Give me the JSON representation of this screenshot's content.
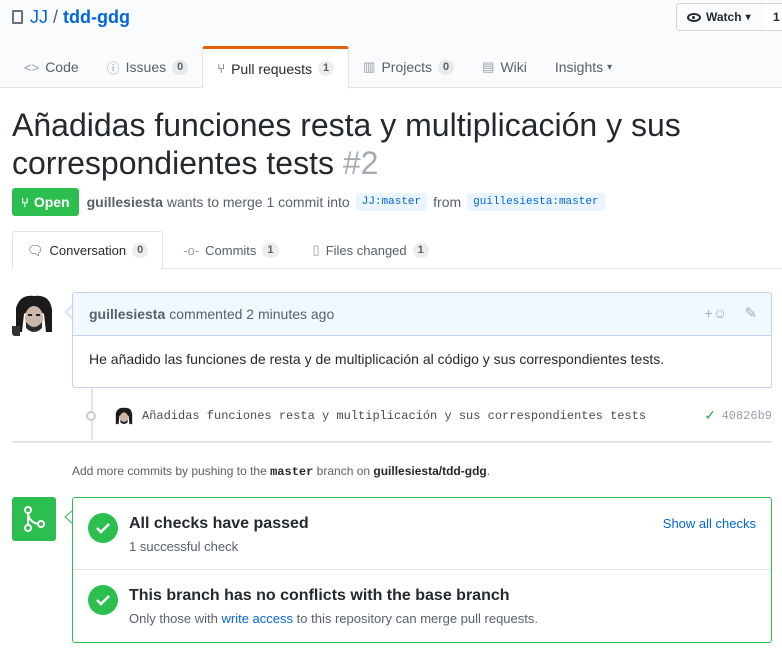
{
  "repo": {
    "owner": "JJ",
    "separator": "/",
    "name": "tdd-gdg"
  },
  "watch": {
    "label": "Watch",
    "caret": "▾",
    "count": "1"
  },
  "tabs": [
    {
      "icon": "<>",
      "label": "Code",
      "count": ""
    },
    {
      "icon": "ⓘ",
      "label": "Issues",
      "count": "0"
    },
    {
      "icon": "⑂",
      "label": "Pull requests",
      "count": "1"
    },
    {
      "icon": "▥",
      "label": "Projects",
      "count": "0"
    },
    {
      "icon": "▤",
      "label": "Wiki",
      "count": ""
    },
    {
      "icon": "",
      "label": "Insights",
      "count": "",
      "caret": "▾"
    }
  ],
  "pr": {
    "title": "Añadidas funciones resta y multiplicación y sus correspondientes tests",
    "number": "#2",
    "state": "Open",
    "author": "guillesiesta",
    "action": "wants to merge 1 commit into",
    "base_ref": "JJ:master",
    "from": "from",
    "head_ref": "guillesiesta:master"
  },
  "pr_tabs": [
    {
      "label": "Conversation",
      "count": "0"
    },
    {
      "label": "Commits",
      "count": "1"
    },
    {
      "label": "Files changed",
      "count": "1"
    }
  ],
  "comment": {
    "author": "guillesiesta",
    "time": "commented 2 minutes ago",
    "react": "+☺",
    "body": "He añadido las funciones de resta y de multiplicación al código y sus correspondientes tests."
  },
  "commit": {
    "message": "Añadidas funciones resta y multiplicación y sus correspondientes tests",
    "sha": "40826b9",
    "status": "✓"
  },
  "hint": {
    "prefix": "Add more commits by pushing to the",
    "branch": "master",
    "middle": "branch on",
    "repo": "guillesiesta/tdd-gdg",
    "suffix": "."
  },
  "checks": {
    "title": "All checks have passed",
    "subtitle": "1 successful check",
    "show_all": "Show all checks"
  },
  "conflicts": {
    "title": "This branch has no conflicts with the base branch",
    "sub_prefix": "Only those with",
    "sub_link": "write access",
    "sub_suffix": "to this repository can merge pull requests."
  },
  "colors": {
    "green": "#2cbe4e",
    "link": "#0366d6",
    "orange": "#e36209"
  }
}
